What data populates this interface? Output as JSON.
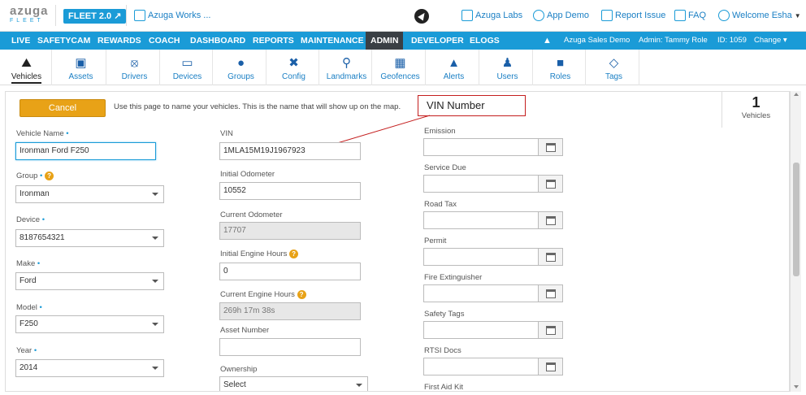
{
  "header": {
    "logo_main": "azuga",
    "logo_sub": "FLEET",
    "fleet_badge": "FLEET 2.0",
    "works_link": "Azuga Works ...",
    "labs_link": "Azuga Labs",
    "appdemo_link": "App Demo",
    "report_link": "Report Issue",
    "faq_link": "FAQ",
    "welcome": "Welcome Esha"
  },
  "nav": {
    "items": [
      "LIVE",
      "SAFETYCAM",
      "REWARDS",
      "COACH",
      "DASHBOARD",
      "REPORTS",
      "MAINTENANCE",
      "ADMIN",
      "DEVELOPER",
      "ELOGS"
    ],
    "active": "ADMIN",
    "account": "Azuga Sales Demo",
    "role": "Admin: Tammy Role",
    "id": "ID: 1059",
    "change": "Change"
  },
  "iconbar": {
    "items": [
      {
        "label": "Vehicles",
        "icon": "car-icon"
      },
      {
        "label": "Assets",
        "icon": "trailer-icon"
      },
      {
        "label": "Drivers",
        "icon": "steering-wheel-icon"
      },
      {
        "label": "Devices",
        "icon": "device-icon"
      },
      {
        "label": "Groups",
        "icon": "groups-icon"
      },
      {
        "label": "Config",
        "icon": "tools-icon"
      },
      {
        "label": "Landmarks",
        "icon": "map-pin-icon"
      },
      {
        "label": "Geofences",
        "icon": "fence-icon"
      },
      {
        "label": "Alerts",
        "icon": "alert-icon"
      },
      {
        "label": "Users",
        "icon": "user-icon"
      },
      {
        "label": "Roles",
        "icon": "lock-icon"
      },
      {
        "label": "Tags",
        "icon": "tag-icon"
      }
    ],
    "active": "Vehicles"
  },
  "page": {
    "cancel": "Cancel",
    "hint": "Use this page to name your vehicles. This is the name that will show up on the map.",
    "annotation": "VIN Number",
    "count": "1",
    "count_label": "Vehicles"
  },
  "form": {
    "vehicle_name_label": "Vehicle Name",
    "vehicle_name": "Ironman Ford F250",
    "group_label": "Group",
    "group": "Ironman",
    "device_label": "Device",
    "device": "8187654321",
    "make_label": "Make",
    "make": "Ford",
    "model_label": "Model",
    "model": "F250",
    "year_label": "Year",
    "year": "2014",
    "vin_label": "VIN",
    "vin": "1MLA15M19J1967923",
    "init_odo_label": "Initial Odometer",
    "init_odo": "10552",
    "cur_odo_label": "Current Odometer",
    "cur_odo": "17707",
    "init_eng_label": "Initial Engine Hours",
    "init_eng": "0",
    "cur_eng_label": "Current Engine Hours",
    "cur_eng": "269h 17m 38s",
    "asset_label": "Asset Number",
    "asset": "",
    "ownership_label": "Ownership",
    "ownership": "Select",
    "emission_label": "Emission",
    "service_label": "Service Due",
    "roadtax_label": "Road Tax",
    "permit_label": "Permit",
    "fire_label": "Fire Extinguisher",
    "safety_label": "Safety Tags",
    "rtsi_label": "RTSI Docs",
    "firstaid_label": "First Aid Kit"
  }
}
